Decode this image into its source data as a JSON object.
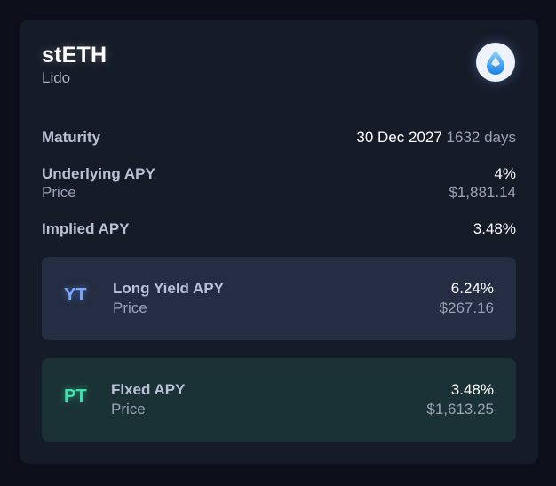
{
  "asset": {
    "name": "stETH",
    "protocol": "Lido",
    "logo_icon": "lido-drop-icon"
  },
  "maturity": {
    "label": "Maturity",
    "date": "30 Dec 2027",
    "days": "1632 days"
  },
  "underlying": {
    "label": "Underlying APY",
    "apy": "4%",
    "price_label": "Price",
    "price": "$1,881.14"
  },
  "implied": {
    "label": "Implied APY",
    "apy": "3.48%"
  },
  "yt": {
    "badge": "YT",
    "label": "Long Yield APY",
    "apy": "6.24%",
    "price_label": "Price",
    "price": "$267.16"
  },
  "pt": {
    "badge": "PT",
    "label": "Fixed APY",
    "apy": "3.48%",
    "price_label": "Price",
    "price": "$1,613.25"
  },
  "colors": {
    "background": "#0c0f1a",
    "card": "#161b28",
    "yt_box": "#242d41",
    "pt_box": "#1a3235",
    "yt_accent": "#7aa7ff",
    "pt_accent": "#3fe3a9"
  }
}
